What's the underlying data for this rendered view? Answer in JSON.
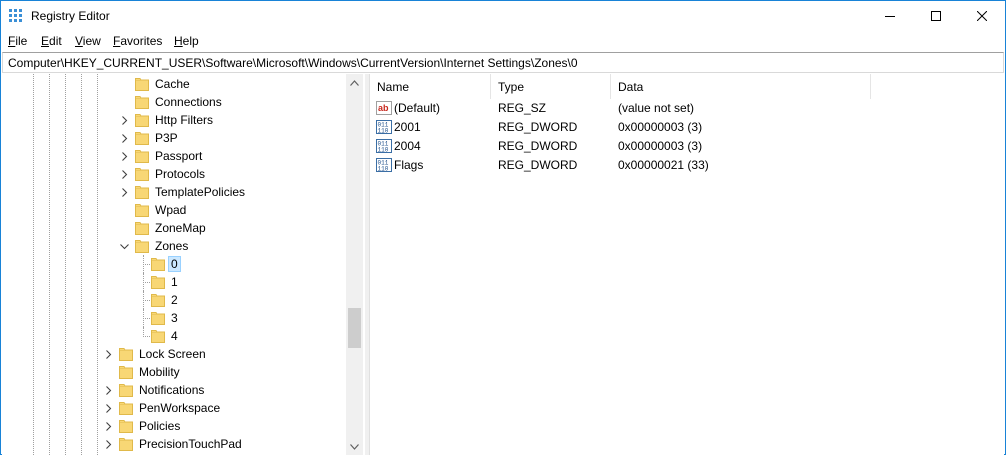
{
  "window": {
    "title": "Registry Editor",
    "controls": {
      "minimize": "minimize",
      "maximize": "maximize",
      "close": "close"
    }
  },
  "menu": [
    "File",
    "Edit",
    "View",
    "Favorites",
    "Help"
  ],
  "address": "Computer\\HKEY_CURRENT_USER\\Software\\Microsoft\\Windows\\CurrentVersion\\Internet Settings\\Zones\\0",
  "tree": {
    "items": [
      {
        "label": "Cache",
        "level": 2,
        "arrow": "none"
      },
      {
        "label": "Connections",
        "level": 2,
        "arrow": "none"
      },
      {
        "label": "Http Filters",
        "level": 2,
        "arrow": "collapsed"
      },
      {
        "label": "P3P",
        "level": 2,
        "arrow": "collapsed"
      },
      {
        "label": "Passport",
        "level": 2,
        "arrow": "collapsed"
      },
      {
        "label": "Protocols",
        "level": 2,
        "arrow": "collapsed"
      },
      {
        "label": "TemplatePolicies",
        "level": 2,
        "arrow": "collapsed"
      },
      {
        "label": "Wpad",
        "level": 2,
        "arrow": "none"
      },
      {
        "label": "ZoneMap",
        "level": 2,
        "arrow": "none"
      },
      {
        "label": "Zones",
        "level": 2,
        "arrow": "expanded"
      },
      {
        "label": "0",
        "level": 3,
        "arrow": "none",
        "selected": true
      },
      {
        "label": "1",
        "level": 3,
        "arrow": "none"
      },
      {
        "label": "2",
        "level": 3,
        "arrow": "none"
      },
      {
        "label": "3",
        "level": 3,
        "arrow": "none"
      },
      {
        "label": "4",
        "level": 3,
        "arrow": "none"
      },
      {
        "label": "Lock Screen",
        "level": 1,
        "arrow": "collapsed"
      },
      {
        "label": "Mobility",
        "level": 1,
        "arrow": "none"
      },
      {
        "label": "Notifications",
        "level": 1,
        "arrow": "collapsed"
      },
      {
        "label": "PenWorkspace",
        "level": 1,
        "arrow": "collapsed"
      },
      {
        "label": "Policies",
        "level": 1,
        "arrow": "collapsed"
      },
      {
        "label": "PrecisionTouchPad",
        "level": 1,
        "arrow": "collapsed"
      }
    ]
  },
  "columns": [
    "Name",
    "Type",
    "Data"
  ],
  "values": [
    {
      "name": "(Default)",
      "type": "REG_SZ",
      "data": "(value not set)",
      "icon": "string-value-icon"
    },
    {
      "name": "2001",
      "type": "REG_DWORD",
      "data": "0x00000003 (3)",
      "icon": "binary-value-icon"
    },
    {
      "name": "2004",
      "type": "REG_DWORD",
      "data": "0x00000003 (3)",
      "icon": "binary-value-icon"
    },
    {
      "name": "Flags",
      "type": "REG_DWORD",
      "data": "0x00000021 (33)",
      "icon": "binary-value-icon"
    }
  ],
  "colors": {
    "window_border": "#1883d7",
    "selection_bg": "#cce8ff",
    "selection_border": "#99d1ff",
    "folder": "#f8d775",
    "folder_edge": "#e0b94a"
  }
}
